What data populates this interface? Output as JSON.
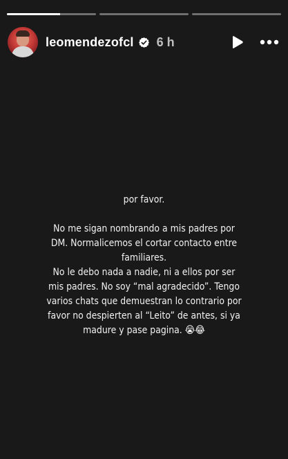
{
  "progress": {
    "segments": [
      {
        "fill": 0.6
      },
      {
        "fill": 0
      },
      {
        "fill": 0
      }
    ]
  },
  "header": {
    "username": "leomendezofcl",
    "time": "6 h",
    "icons": {
      "verified": "verified-badge-icon",
      "play": "play-icon",
      "more": "more-options-icon"
    }
  },
  "message": {
    "line1": "por favor.",
    "paragraph": "No me sigan nombrando a mis padres por DM. Normalicemos el cortar contacto entre familiares.",
    "paragraph2": "No le debo nada a nadie, ni a ellos por ser mis padres. No soy “mal agradecido”. Tengo varios chats que demuestran lo contrario por favor no despierten al “Leito” de antes, si ya madure y pase pagina. 😭😂"
  },
  "colors": {
    "background": "#191919",
    "text": "#f2f2f2"
  }
}
